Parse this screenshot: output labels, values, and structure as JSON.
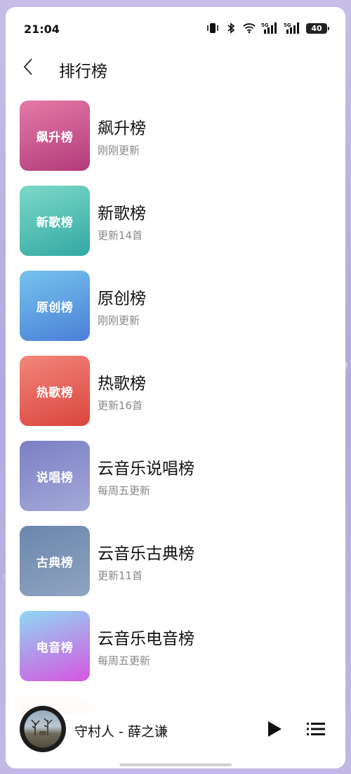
{
  "status_bar": {
    "time": "21:04",
    "battery": "40",
    "icons": [
      "vibrate-icon",
      "bluetooth-icon",
      "wifi-icon",
      "signal-5g-icon",
      "signal-5g-icon"
    ]
  },
  "header": {
    "title": "排行榜",
    "back_icon": "chevron-left-icon"
  },
  "charts": [
    {
      "cover_label": "飙升榜",
      "name": "飙升榜",
      "subtitle": "刚刚更新",
      "gradient": [
        "#e57aa7",
        "#b23b7a"
      ]
    },
    {
      "cover_label": "新歌榜",
      "name": "新歌榜",
      "subtitle": "更新14首",
      "gradient": [
        "#7dd9c8",
        "#32a8a3"
      ]
    },
    {
      "cover_label": "原创榜",
      "name": "原创榜",
      "subtitle": "刚刚更新",
      "gradient": [
        "#76c4ee",
        "#4a7fd6"
      ]
    },
    {
      "cover_label": "热歌榜",
      "name": "热歌榜",
      "subtitle": "更新16首",
      "gradient": [
        "#f3867a",
        "#d9453e"
      ]
    },
    {
      "cover_label": "说唱榜",
      "name": "云音乐说唱榜",
      "subtitle": "每周五更新",
      "gradient": [
        "#7b7fc4",
        "#a4a9d8"
      ]
    },
    {
      "cover_label": "古典榜",
      "name": "云音乐古典榜",
      "subtitle": "更新11首",
      "gradient": [
        "#6b86ad",
        "#8fa4c0"
      ]
    },
    {
      "cover_label": "电音榜",
      "name": "云音乐电音榜",
      "subtitle": "每周五更新",
      "gradient": [
        "#8fd8f3",
        "#d655e0"
      ]
    }
  ],
  "player": {
    "song": "守村人 - 薛之谦",
    "play_icon": "play-icon",
    "playlist_icon": "playlist-icon"
  }
}
